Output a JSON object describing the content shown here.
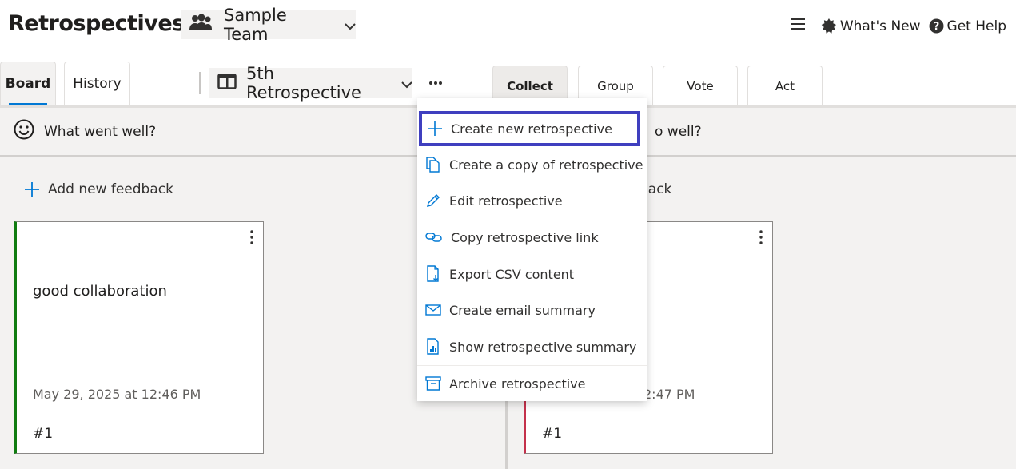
{
  "header": {
    "app_title": "Retrospectives",
    "team_name": "Sample Team",
    "whats_new": "What's New",
    "get_help": "Get Help"
  },
  "tabs": [
    {
      "label": "Board",
      "active": true
    },
    {
      "label": "History",
      "active": false
    }
  ],
  "retro_name": "5th Retrospective",
  "phases": [
    {
      "label": "Collect",
      "active": true
    },
    {
      "label": "Group",
      "active": false
    },
    {
      "label": "Vote",
      "active": false
    },
    {
      "label": "Act",
      "active": false
    }
  ],
  "columns": [
    {
      "title": "What went well?",
      "add_label": "Add new feedback",
      "accent": "#107c10",
      "card": {
        "text": "good collaboration",
        "date": "May 29, 2025 at 12:46 PM",
        "number": "#1"
      }
    },
    {
      "title": "o well?",
      "add_label": "back",
      "accent": "#c4314b",
      "card": {
        "text": "",
        "date": "2:47 PM",
        "number": "#1"
      }
    }
  ],
  "menu": {
    "items": [
      {
        "label": "Create new retrospective",
        "icon": "plus-icon"
      },
      {
        "label": "Create a copy of retrospective",
        "icon": "copy-icon"
      },
      {
        "label": "Edit retrospective",
        "icon": "pencil-icon"
      },
      {
        "label": "Copy retrospective link",
        "icon": "link-icon"
      },
      {
        "label": "Export CSV content",
        "icon": "export-file-icon"
      },
      {
        "label": "Create email summary",
        "icon": "mail-icon"
      },
      {
        "label": "Show retrospective summary",
        "icon": "report-icon"
      },
      {
        "label": "Archive retrospective",
        "icon": "archive-icon"
      }
    ]
  },
  "colors": {
    "accent": "#0078d4",
    "highlight": "#3f3fbf"
  }
}
